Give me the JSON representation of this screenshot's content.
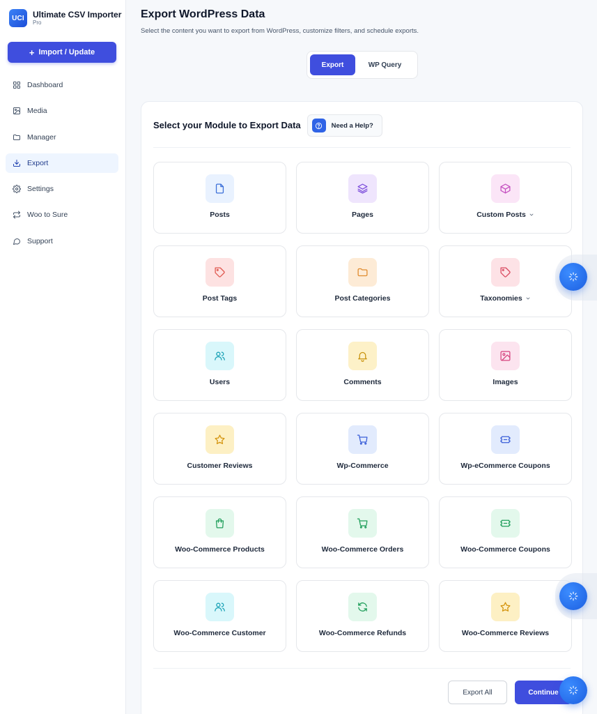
{
  "sidebar": {
    "brand": {
      "logo": "UCI",
      "title": "Ultimate CSV Importer",
      "subtitle": "Pro"
    },
    "import_button": {
      "icon": "plus-icon",
      "label": "Import / Update"
    },
    "items": [
      {
        "label": "Dashboard",
        "icon": "grid-icon",
        "active": false
      },
      {
        "label": "Media",
        "icon": "image-icon",
        "active": false
      },
      {
        "label": "Manager",
        "icon": "folder-icon",
        "active": false
      },
      {
        "label": "Export",
        "icon": "download-icon",
        "active": true
      },
      {
        "label": "Settings",
        "icon": "gear-icon",
        "active": false
      },
      {
        "label": "Woo to Sure",
        "icon": "swap-icon",
        "active": false
      },
      {
        "label": "Support",
        "icon": "chat-icon",
        "active": false
      }
    ]
  },
  "header": {
    "title": "Export WordPress Data",
    "subtitle": "Select the content you want to export from WordPress, customize filters, and schedule exports."
  },
  "toggle": {
    "export_label": "Export",
    "wpquery_label": "WP Query"
  },
  "card": {
    "title": "Select your Module to Export Data",
    "help_label": "Need a Help?",
    "modules": [
      {
        "label": "Posts",
        "icon": "file-icon",
        "bg": "#e9f2ff",
        "color": "#3b6fd8",
        "dropdown": false
      },
      {
        "label": "Pages",
        "icon": "layers-icon",
        "bg": "#efe5fd",
        "color": "#7c4ddb",
        "dropdown": false
      },
      {
        "label": "Custom Posts",
        "icon": "box-icon",
        "bg": "#fbe5f7",
        "color": "#c44fc0",
        "dropdown": true
      },
      {
        "label": "Post Tags",
        "icon": "tag-icon",
        "bg": "#fde2e2",
        "color": "#e0584f",
        "dropdown": false
      },
      {
        "label": "Post Categories",
        "icon": "folder-icon",
        "bg": "#fdebd6",
        "color": "#e08a2c",
        "dropdown": false
      },
      {
        "label": "Taxonomies",
        "icon": "tag-icon",
        "bg": "#fde2e6",
        "color": "#d9485f",
        "dropdown": true
      },
      {
        "label": "Users",
        "icon": "users-icon",
        "bg": "#d9f7fb",
        "color": "#1aa2b6",
        "dropdown": false
      },
      {
        "label": "Comments",
        "icon": "bell-icon",
        "bg": "#fdf1c8",
        "color": "#c9930d",
        "dropdown": false
      },
      {
        "label": "Images",
        "icon": "image-icon",
        "bg": "#fce4ef",
        "color": "#d6457f",
        "dropdown": false
      },
      {
        "label": "Customer Reviews",
        "icon": "star-icon",
        "bg": "#fdf0c4",
        "color": "#d4940e",
        "dropdown": false
      },
      {
        "label": "Wp-Commerce",
        "icon": "cart-icon",
        "bg": "#e2ebfd",
        "color": "#3b5fd8",
        "dropdown": false
      },
      {
        "label": "Wp-eCommerce Coupons",
        "icon": "ticket-icon",
        "bg": "#e2ebfd",
        "color": "#3b5fd8",
        "dropdown": false
      },
      {
        "label": "Woo-Commerce Products",
        "icon": "bag-icon",
        "bg": "#e3f8ec",
        "color": "#1f9e5a",
        "dropdown": false
      },
      {
        "label": "Woo-Commerce Orders",
        "icon": "cart-icon",
        "bg": "#e3f8ec",
        "color": "#1f9e5a",
        "dropdown": false
      },
      {
        "label": "Woo-Commerce Coupons",
        "icon": "ticket-icon",
        "bg": "#e3f8ec",
        "color": "#1f9e5a",
        "dropdown": false
      },
      {
        "label": "Woo-Commerce Customer",
        "icon": "users-icon",
        "bg": "#d9f7fb",
        "color": "#1aa2b6",
        "dropdown": false
      },
      {
        "label": "Woo-Commerce Refunds",
        "icon": "refresh-icon",
        "bg": "#e3f8ec",
        "color": "#1f9e5a",
        "dropdown": false
      },
      {
        "label": "Woo-Commerce Reviews",
        "icon": "star-icon",
        "bg": "#fdf0c4",
        "color": "#d4940e",
        "dropdown": false
      }
    ],
    "export_all_label": "Export All",
    "continue_label": "Continue"
  },
  "colors": {
    "primary": "#3f4ede",
    "accent_blue": "#2f63e6"
  }
}
